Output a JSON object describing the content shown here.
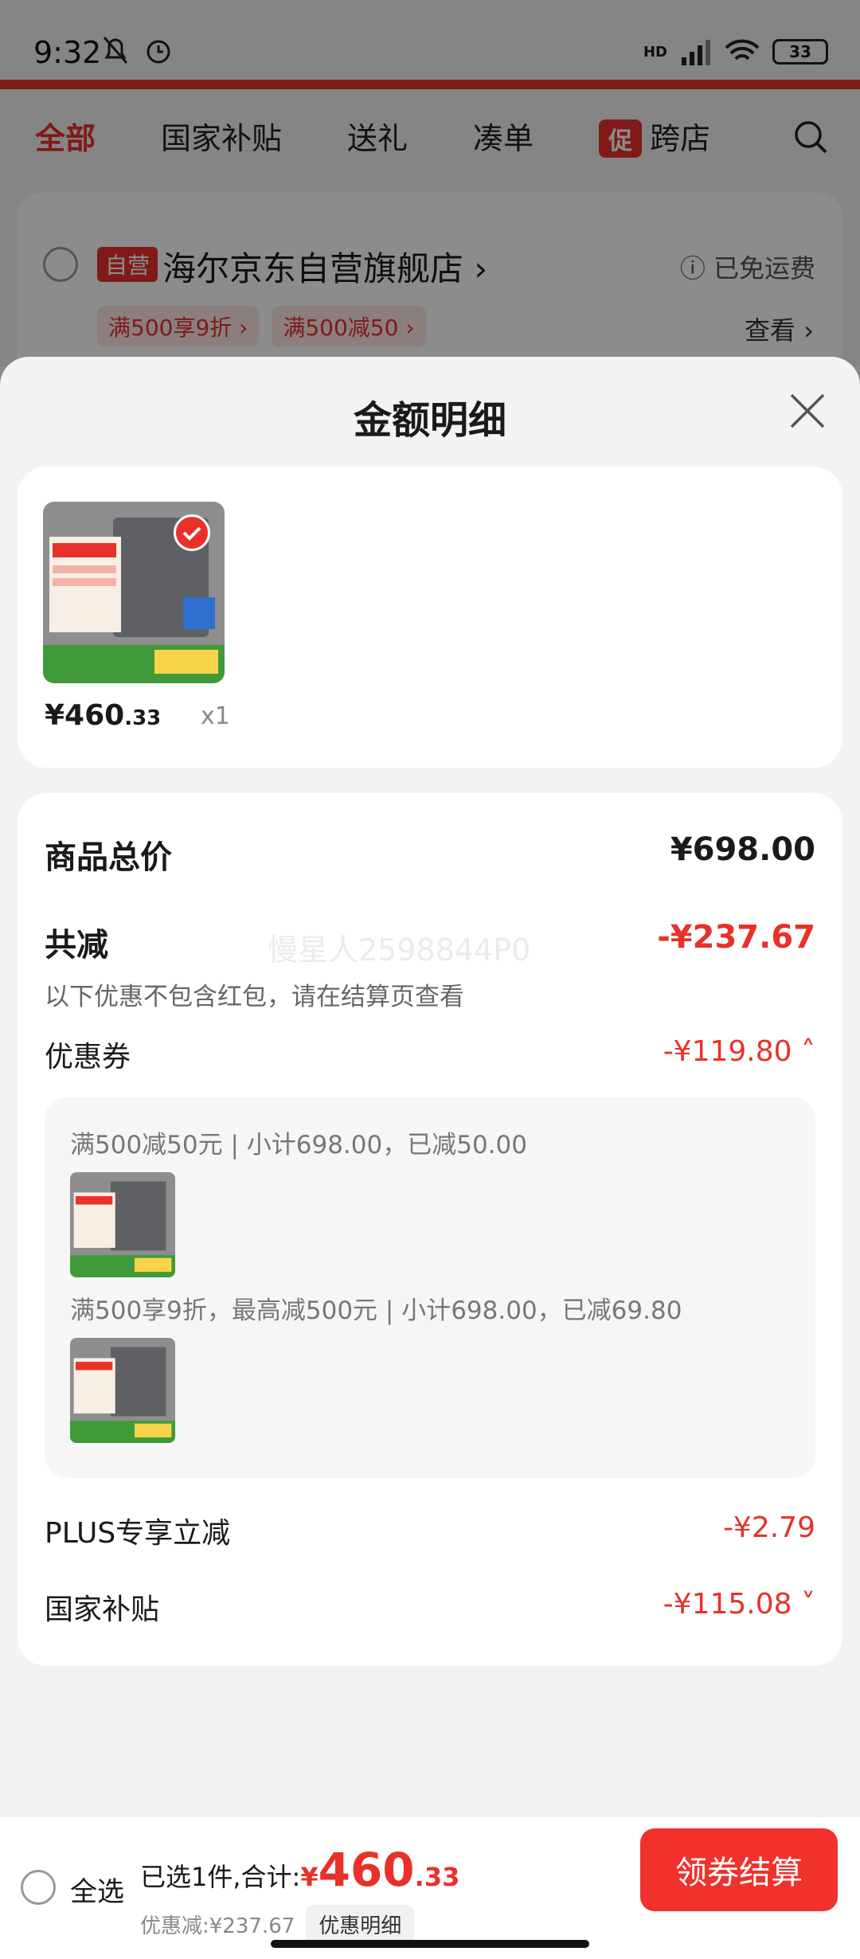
{
  "status_bar": {
    "time": "9:32",
    "battery": "33",
    "network": "HD"
  },
  "tabs": [
    "全部",
    "国家补贴",
    "送礼",
    "凑单",
    "跨店"
  ],
  "promo_badge": "促",
  "shop": {
    "self_tag": "自营",
    "name": "海尔京东自营旗舰店 ›",
    "free_shipping": "ⓘ 已免运费",
    "coupon_tags": [
      "满500享9折 ›",
      "满500减50 ›"
    ],
    "view_more": "查看 ›"
  },
  "sheet": {
    "title": "金额明细",
    "goods": {
      "price_int": "¥460",
      "price_dec": ".33",
      "qty": "x1"
    },
    "total_label": "商品总价",
    "total_value": "¥698.00",
    "discount_label": "共减",
    "discount_value": "-¥237.67",
    "discount_note": "以下优惠不包含红包，请在结算页查看",
    "coupon_label": "优惠券",
    "coupon_value": "-¥119.80 ˄",
    "coupon_lines": [
      "满500减50元 | 小计698.00，已减50.00",
      "满500享9折，最高减500元 | 小计698.00，已减69.80"
    ],
    "plus_label": "PLUS专享立减",
    "plus_value": "-¥2.79",
    "subsidy_label": "国家补贴",
    "subsidy_value": "-¥115.08 ˅",
    "watermark": "慢星人2598844P0"
  },
  "bottom": {
    "select_all": "全选",
    "selected_text": "已选1件,合计:",
    "yen": "¥",
    "amount": "460",
    "amount_dec": ".33",
    "discount_text": "优惠减:¥237.67",
    "detail_button": "优惠明细",
    "checkout": "领券结算"
  },
  "colors": {
    "accent": "#e8312a",
    "sheet_bg": "#f3f3f3"
  }
}
